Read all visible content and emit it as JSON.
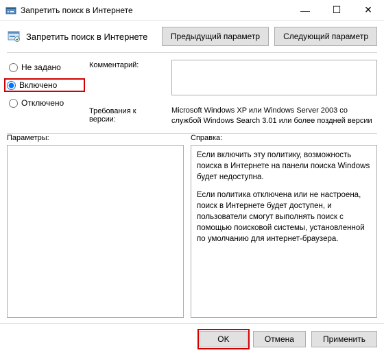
{
  "window": {
    "title": "Запретить поиск в Интернете",
    "minimize_glyph": "—",
    "maximize_glyph": "☐",
    "close_glyph": "✕"
  },
  "header": {
    "subtitle": "Запретить поиск в Интернете",
    "prev_btn": "Предыдущий параметр",
    "next_btn": "Следующий параметр"
  },
  "radios": {
    "not_configured": "Не задано",
    "enabled": "Включено",
    "disabled": "Отключено",
    "selected": "enabled"
  },
  "fields": {
    "comment_label": "Комментарий:",
    "comment_value": "",
    "req_label": "Требования к версии:",
    "req_value": "Microsoft Windows XP или Windows Server 2003 со службой Windows Search 3.01 или более поздней версии"
  },
  "lower": {
    "params_label": "Параметры:",
    "help_label": "Справка:",
    "help_p1": "Если включить эту политику, возможность поиска в Интернете на панели поиска Windows будет недоступна.",
    "help_p2": "Если политика отключена или не настроена, поиск в Интернете будет доступен, и пользователи смогут выполнять поиск с помощью поисковой системы, установленной по умолчанию для интернет-браузера."
  },
  "footer": {
    "ok": "OK",
    "cancel": "Отмена",
    "apply": "Применить"
  }
}
